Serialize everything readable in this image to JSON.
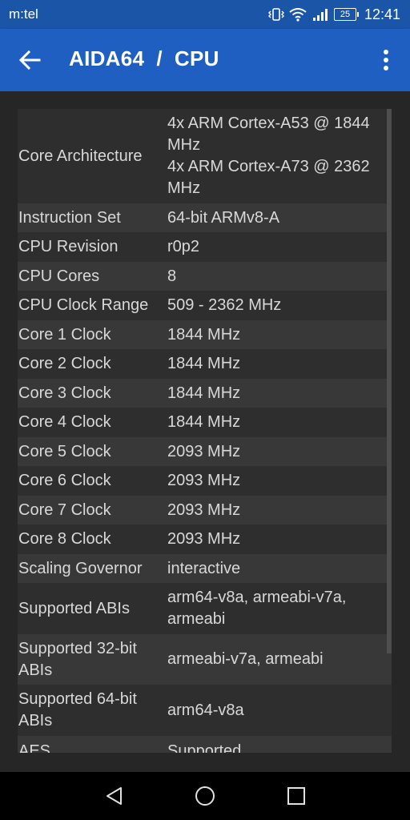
{
  "status_bar": {
    "carrier": "m:tel",
    "battery": "25",
    "time": "12:41"
  },
  "app_bar": {
    "title": "AIDA64  /  CPU"
  },
  "rows": [
    {
      "label": "Core Architecture",
      "value": "4x ARM Cortex-A53 @ 1844 MHz\n4x ARM Cortex-A73 @ 2362 MHz"
    },
    {
      "label": "Instruction Set",
      "value": "64-bit ARMv8-A"
    },
    {
      "label": "CPU Revision",
      "value": "r0p2"
    },
    {
      "label": "CPU Cores",
      "value": "8"
    },
    {
      "label": "CPU Clock Range",
      "value": "509 - 2362 MHz"
    },
    {
      "label": "Core 1 Clock",
      "value": "1844 MHz"
    },
    {
      "label": "Core 2 Clock",
      "value": "1844 MHz"
    },
    {
      "label": "Core 3 Clock",
      "value": "1844 MHz"
    },
    {
      "label": "Core 4 Clock",
      "value": "1844 MHz"
    },
    {
      "label": "Core 5 Clock",
      "value": "2093 MHz"
    },
    {
      "label": "Core 6 Clock",
      "value": "2093 MHz"
    },
    {
      "label": "Core 7 Clock",
      "value": "2093 MHz"
    },
    {
      "label": "Core 8 Clock",
      "value": "2093 MHz"
    },
    {
      "label": "Scaling Governor",
      "value": "interactive"
    },
    {
      "label": "Supported ABIs",
      "value": "arm64-v8a, armeabi-v7a, armeabi"
    },
    {
      "label": "Supported 32-bit ABIs",
      "value": "armeabi-v7a, armeabi"
    },
    {
      "label": "Supported 64-bit ABIs",
      "value": "arm64-v8a"
    },
    {
      "label": "AES",
      "value": "Supported"
    }
  ],
  "nav_bar": {
    "back": "back-icon",
    "home": "home-icon",
    "recents": "recents-icon"
  },
  "colors": {
    "status_bar": "#1b55a8",
    "app_bar": "#1f5fc2",
    "background": "#262626",
    "text": "#d8d8d8"
  }
}
